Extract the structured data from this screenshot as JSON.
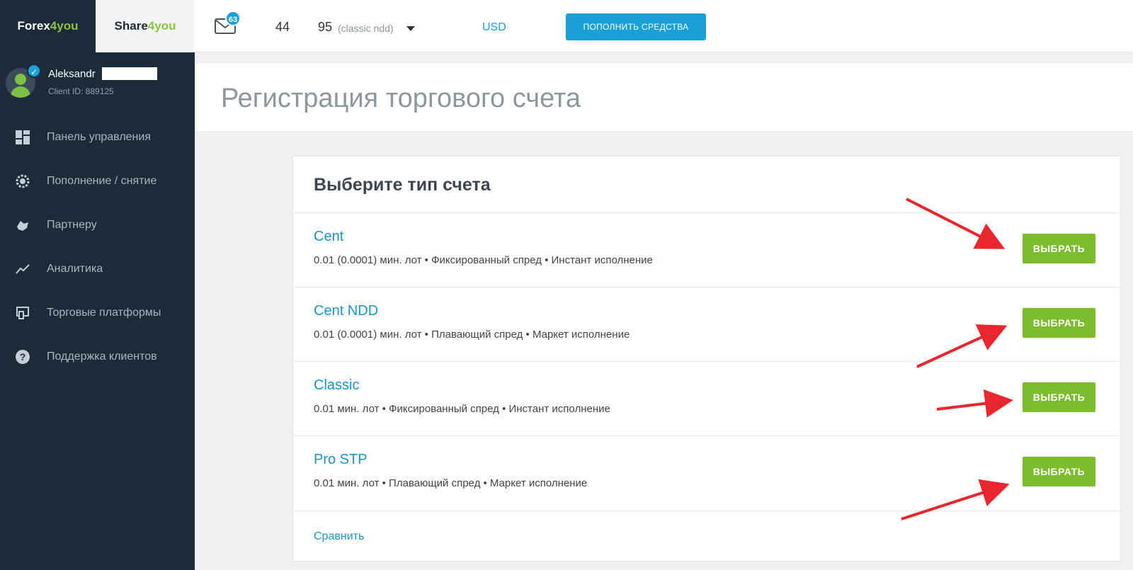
{
  "brand": {
    "forex_prefix": "Forex",
    "forex_accent": "4you",
    "share_prefix": "Share",
    "share_accent": "4you"
  },
  "user": {
    "name": "Aleksandr",
    "client_id": "Client ID: 889125"
  },
  "sidebar": {
    "items": [
      {
        "label": "Панель управления",
        "icon": "dashboard-icon"
      },
      {
        "label": "Пополнение / снятие",
        "icon": "coins-icon"
      },
      {
        "label": "Партнеру",
        "icon": "handshake-icon"
      },
      {
        "label": "Аналитика",
        "icon": "chart-line-icon"
      },
      {
        "label": "Торговые платформы",
        "icon": "platforms-icon"
      },
      {
        "label": "Поддержка клиентов",
        "icon": "help-icon"
      }
    ]
  },
  "topbar": {
    "mail_count": "63",
    "account_partial": "44",
    "account_number": "95",
    "account_type": "(classic ndd)",
    "currency": "USD",
    "deposit_label": "ПОПОЛНИТЬ СРЕДСТВА"
  },
  "page": {
    "title": "Регистрация торгового счета"
  },
  "card": {
    "title": "Выберите тип счета",
    "accounts": [
      {
        "name": "Cent",
        "desc": "0.01 (0.0001) мин. лот • Фиксированный спред • Инстант исполнение",
        "button": "ВЫБРАТЬ"
      },
      {
        "name": "Cent NDD",
        "desc": "0.01 (0.0001) мин. лот • Плавающий спред • Маркет исполнение",
        "button": "ВЫБРАТЬ"
      },
      {
        "name": "Classic",
        "desc": "0.01 мин. лот • Фиксированный спред • Инстант исполнение",
        "button": "ВЫБРАТЬ"
      },
      {
        "name": "Pro STP",
        "desc": "0.01 мин. лот • Плавающий спред • Маркет исполнение",
        "button": "ВЫБРАТЬ"
      }
    ],
    "compare_label": "Сравнить"
  },
  "colors": {
    "sidebar_bg": "#1c2b39",
    "accent_blue": "#1aa0d8",
    "accent_green": "#7bbd2c",
    "arrow_red": "#e8262b"
  }
}
